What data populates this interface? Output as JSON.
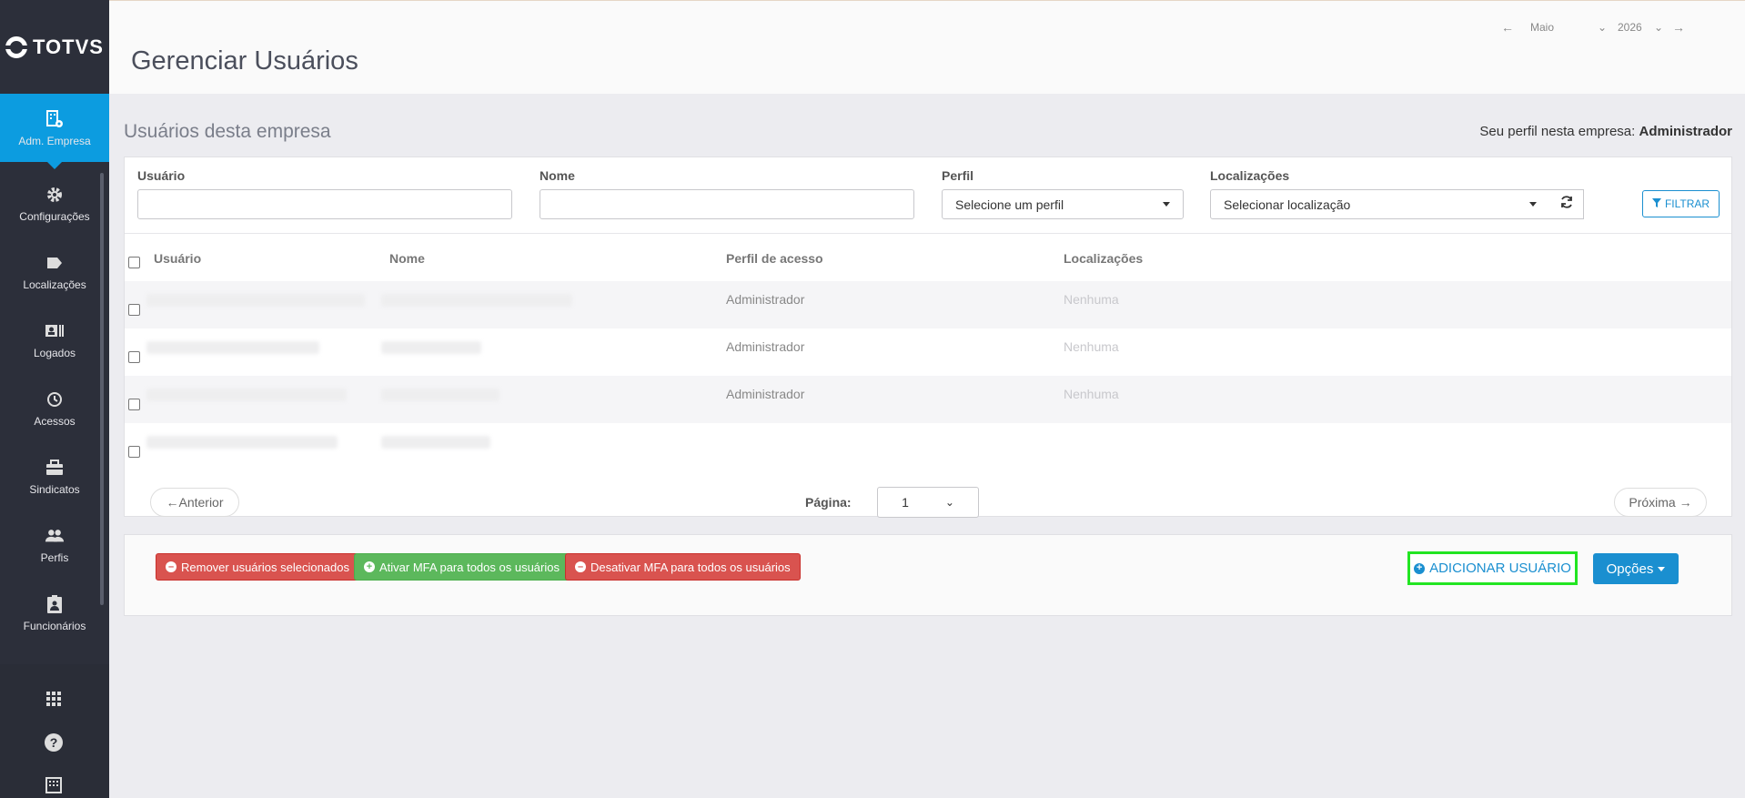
{
  "sidebar": {
    "logo_text": "TOTVS",
    "items": [
      {
        "label": "Adm. Empresa",
        "icon": "building-gear-icon",
        "active": true
      },
      {
        "label": "Configurações",
        "icon": "gear-icon"
      },
      {
        "label": "Localizações",
        "icon": "tag-icon"
      },
      {
        "label": "Logados",
        "icon": "id-card-icon"
      },
      {
        "label": "Acessos",
        "icon": "history-icon"
      },
      {
        "label": "Sindicatos",
        "icon": "briefcase-icon"
      },
      {
        "label": "Perfis",
        "icon": "users-icon"
      },
      {
        "label": "Funcionários",
        "icon": "clipboard-user-icon"
      }
    ],
    "bottom_icons": [
      "apps-grid-icon",
      "help-icon",
      "company-building-icon"
    ]
  },
  "header": {
    "title": "Gerenciar Usuários",
    "month": "Maio",
    "year": "2026"
  },
  "main": {
    "section_title": "Usuários desta empresa",
    "profile_label": "Seu perfil nesta empresa:",
    "profile_value": "Administrador",
    "filters": {
      "usuario_label": "Usuário",
      "usuario_value": "",
      "nome_label": "Nome",
      "nome_value": "",
      "perfil_label": "Perfil",
      "perfil_selected": "Selecione um perfil",
      "localizacoes_label": "Localizações",
      "localizacoes_selected": "Selecionar localização",
      "filter_button": "FILTRAR"
    },
    "table": {
      "headers": [
        "Usuário",
        "Nome",
        "Perfil de acesso",
        "Localizações"
      ],
      "rows": [
        {
          "perfil": "Administrador",
          "localizacoes": "Nenhuma"
        },
        {
          "perfil": "Administrador",
          "localizacoes": "Nenhuma"
        },
        {
          "perfil": "Administrador",
          "localizacoes": "Nenhuma"
        },
        {
          "perfil": "",
          "localizacoes": ""
        }
      ]
    },
    "pagination": {
      "prev": "←Anterior",
      "page_label": "Página:",
      "page_value": "1",
      "next": "Próxima →"
    },
    "actions": {
      "remove": "Remover usuários selecionados",
      "enable_mfa": "Ativar MFA para todos os usuários",
      "disable_mfa": "Desativar MFA para todos os usuários",
      "add_user": "ADICIONAR USUÁRIO",
      "options": "Opções"
    }
  },
  "colors": {
    "accent": "#0c9ce0",
    "sidebar": "#2c2f3a",
    "danger": "#d9534f",
    "success": "#5cb85c",
    "highlight": "#22e522"
  }
}
